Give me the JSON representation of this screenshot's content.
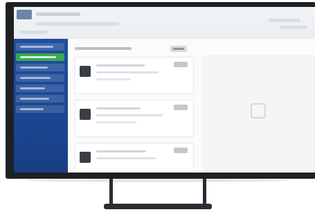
{
  "colors": {
    "sidebar": "#1f4fa0",
    "sidebar_active": "#38a94f",
    "frame": "#1e2124",
    "stand": "#2a2d31"
  },
  "icons": [
    "app-logo",
    "user-avatar-icon",
    "document-icon"
  ]
}
